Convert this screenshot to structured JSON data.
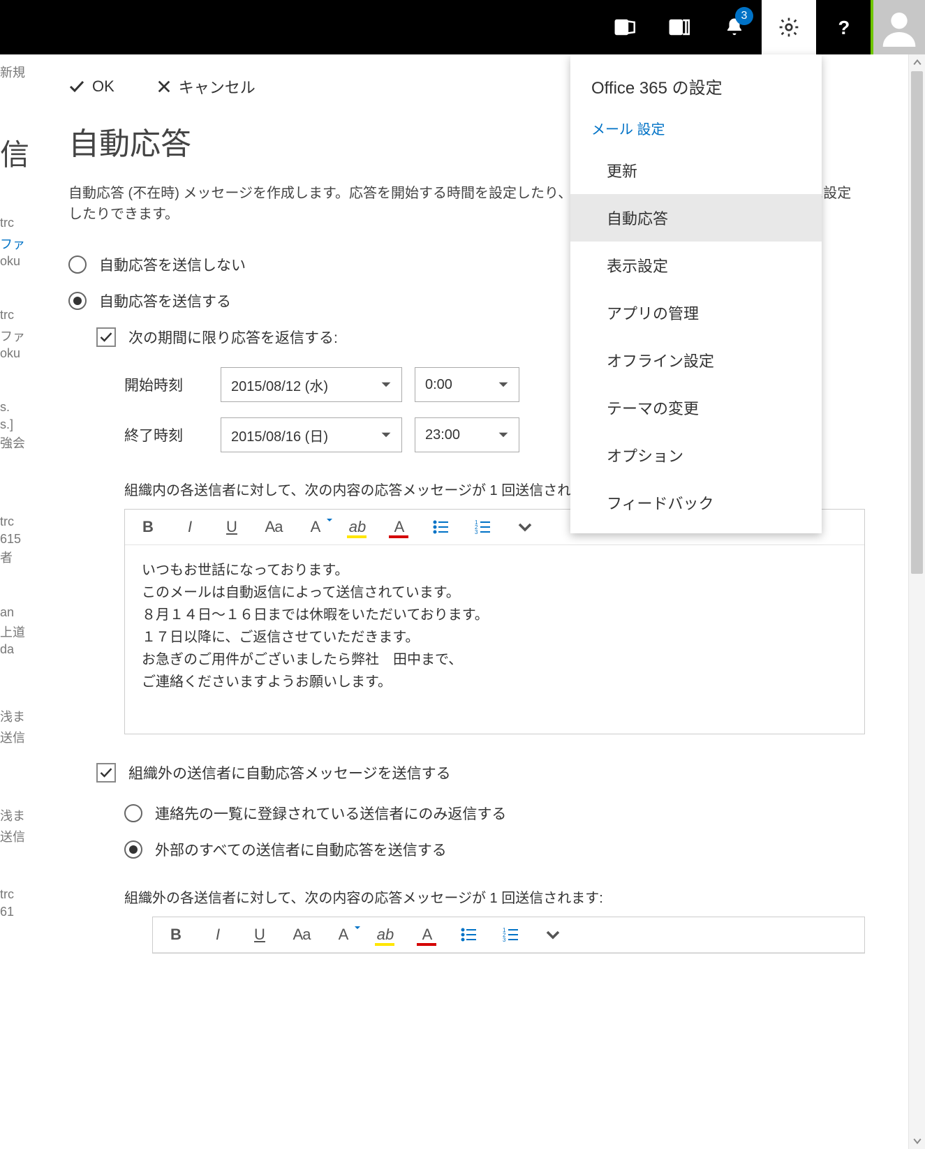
{
  "topbar": {
    "notification_count": "3"
  },
  "left_sliver": {
    "l0": "新規",
    "l1": "信",
    "l2": "trc",
    "l3": "ファ",
    "l4": "oku",
    "l5": "trc",
    "l6": "ファ",
    "l7": "oku",
    "l8": "s.",
    "l9": "s.]",
    "l10": "強会",
    "l11": "trc",
    "l12": "615",
    "l13": "者",
    "l14": "an",
    "l15": "上道",
    "l16": "da",
    "l17": "浅ま",
    "l18": "送信",
    "l19": "浅ま",
    "l20": "送信",
    "l21": "trc",
    "l22": "61"
  },
  "actions": {
    "ok": "OK",
    "cancel": "キャンセル"
  },
  "page": {
    "title": "自動応答",
    "desc": "自動応答 (不在時) メッセージを作成します。応答を開始する時間を設定したり、特定の時刻に開始または終了するように設定したりできます。"
  },
  "radio": {
    "dont_send": "自動応答を送信しない",
    "send": "自動応答を送信する"
  },
  "period": {
    "only_in_period": "次の期間に限り応答を返信する:",
    "start_label": "開始時刻",
    "end_label": "終了時刻",
    "start_date": "2015/08/12 (水)",
    "start_time": "0:00",
    "end_date": "2015/08/16 (日)",
    "end_time": "23:00"
  },
  "internal": {
    "desc": "組織内の各送信者に対して、次の内容の応答メッセージが 1 回送信されます:",
    "body": "いつもお世話になっております。\nこのメールは自動返信によって送信されています。\n８月１４日～１６日までは休暇をいただいております。\n１７日以降に、ご返信させていただきます。\nお急ぎのご用件がございましたら弊社　田中まで、\nご連絡くださいますようお願いします。"
  },
  "external": {
    "send_check": "組織外の送信者に自動応答メッセージを送信する",
    "contacts_only": "連絡先の一覧に登録されている送信者にのみ返信する",
    "all_ext": "外部のすべての送信者に自動応答を送信する",
    "desc": "組織外の各送信者に対して、次の内容の応答メッセージが 1 回送信されます:"
  },
  "editor_toolbar": {
    "b": "B",
    "i": "I",
    "u": "U",
    "size": "Aa",
    "asup": "A",
    "highlight": "ab",
    "color": "A"
  },
  "flyout": {
    "head": "Office 365 の設定",
    "sub": "メール 設定",
    "i0": "更新",
    "i1": "自動応答",
    "i2": "表示設定",
    "i3": "アプリの管理",
    "i4": "オフライン設定",
    "i5": "テーマの変更",
    "i6": "オプション",
    "i7": "フィードバック"
  }
}
